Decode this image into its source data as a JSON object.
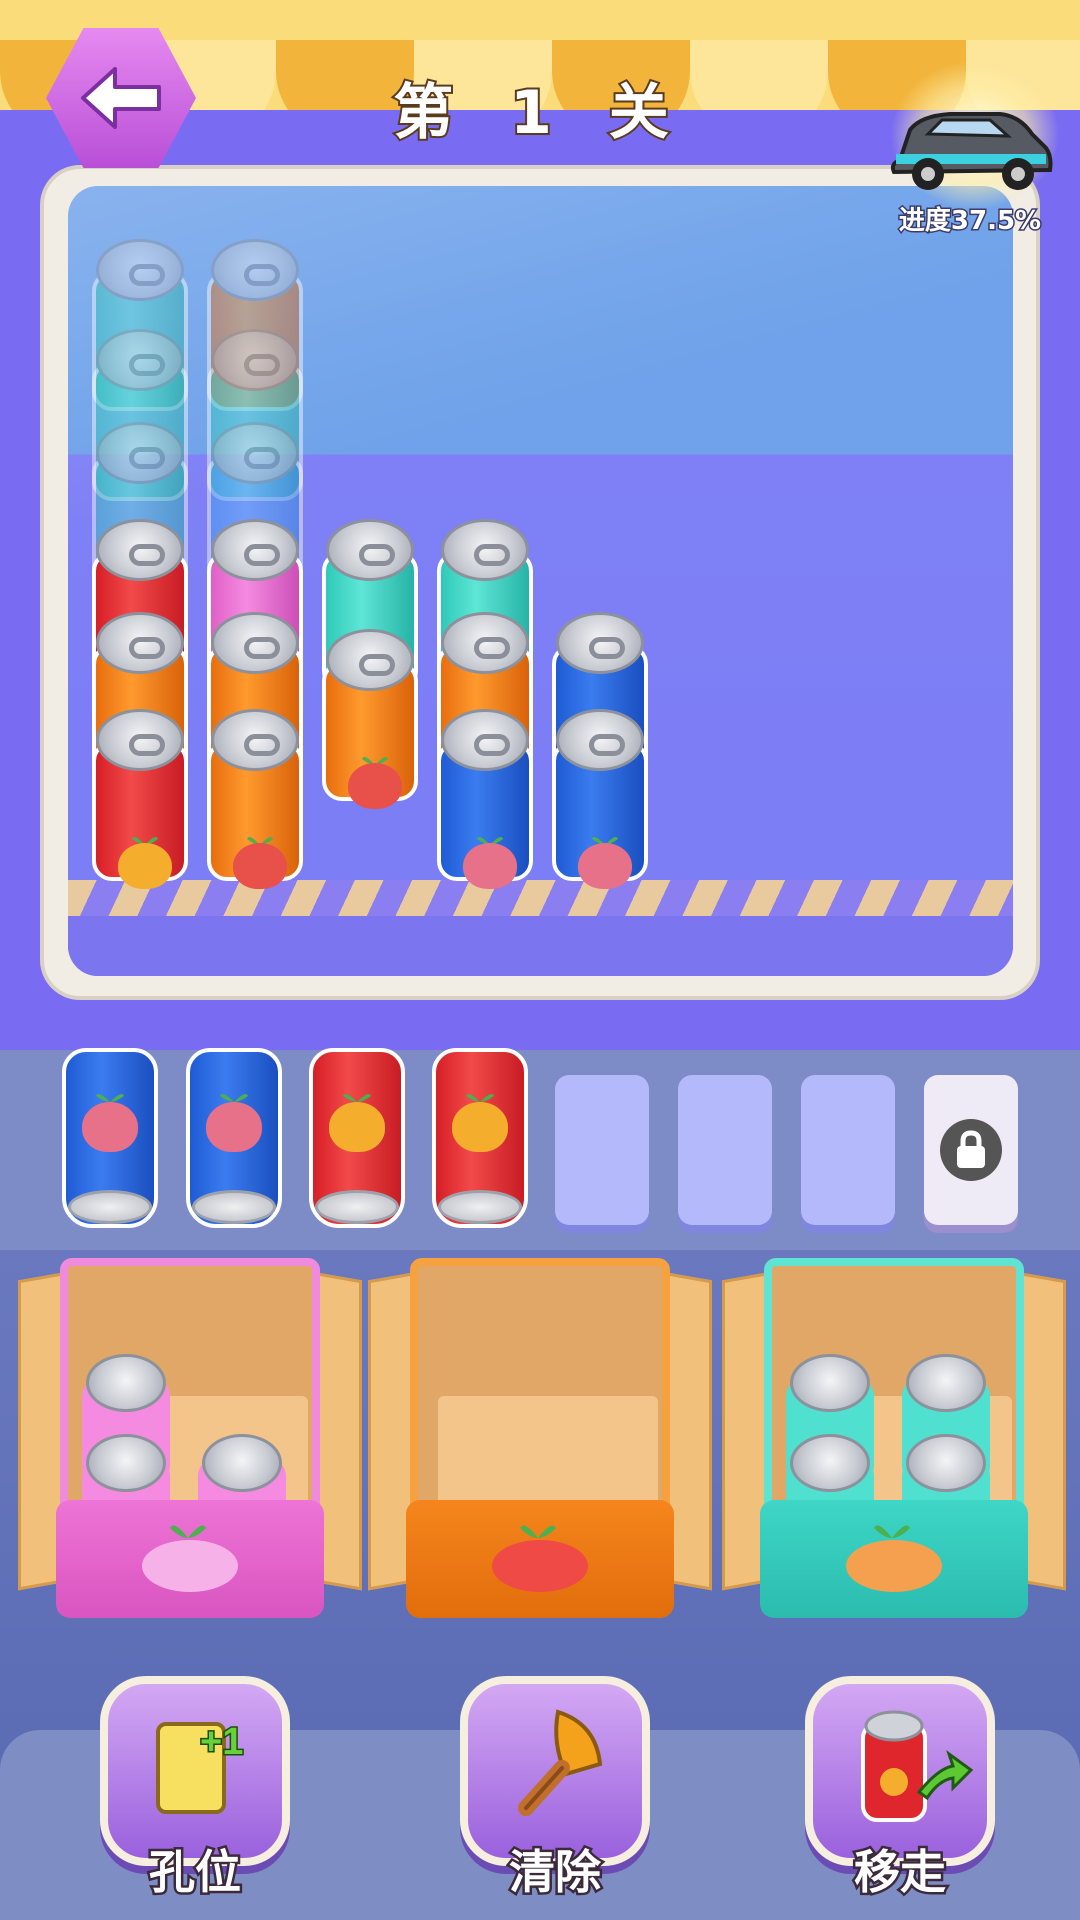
{
  "header": {
    "level_title": "第 1 关",
    "back_icon": "back-arrow-icon",
    "progress_text": "进度37.5%",
    "reward_icon": "car-icon"
  },
  "colors": {
    "awning_yellow": "#fbdc7a",
    "awning_orange": "#f2b43b",
    "machine_purple": "#7a6cf2",
    "red": "#e0262d",
    "orange": "#f5851c",
    "blue": "#2a68e0",
    "teal": "#3ed6c6",
    "pink": "#ee74d6"
  },
  "shelf_columns": [
    [
      "red",
      "orange",
      "red"
    ],
    [
      "orange",
      "orange",
      "pink"
    ],
    [
      "orange",
      "teal"
    ],
    [
      "blue",
      "orange",
      "teal"
    ],
    [
      "blue",
      "blue"
    ]
  ],
  "tray_slots": {
    "filled": [
      "blue",
      "blue",
      "red",
      "red"
    ],
    "empty_count": 3,
    "locked_count": 1,
    "lock_icon": "lock-icon"
  },
  "boxes": [
    {
      "color": "pink",
      "cans": 3
    },
    {
      "color": "orange",
      "cans": 0
    },
    {
      "color": "teal",
      "cans": 4
    }
  ],
  "tools": [
    {
      "label": "孔位",
      "icon": "add-slot-icon",
      "badge": "+1"
    },
    {
      "label": "清除",
      "icon": "broom-icon"
    },
    {
      "label": "移走",
      "icon": "move-can-icon"
    }
  ]
}
